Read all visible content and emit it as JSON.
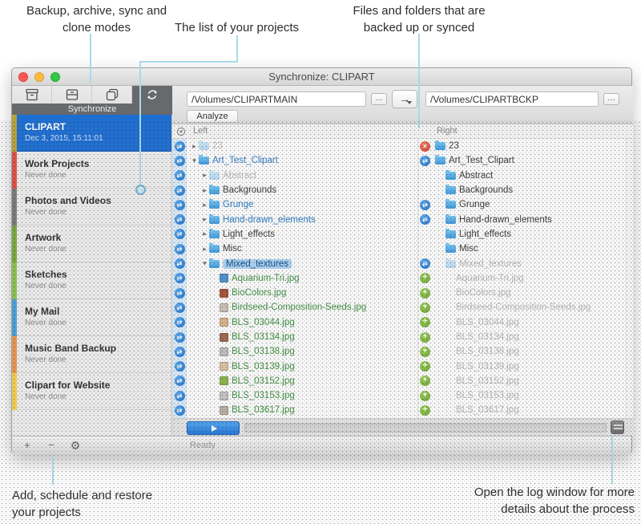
{
  "annotations": {
    "top_left": {
      "line1": "Backup, archive, sync and",
      "line2": "clone modes"
    },
    "top_mid": {
      "line1": "The list of your projects"
    },
    "top_right": {
      "line1": "Files and folders that are",
      "line2": "backed up or synced"
    },
    "bottom_left": {
      "line1": "Add, schedule and restore",
      "line2": "your projects"
    },
    "bottom_right": {
      "line1": "Open the log window for more",
      "line2": "details about the process"
    }
  },
  "icons": {
    "plus": "+",
    "minus": "−",
    "gear": "⚙",
    "sync_glyph": "⇄",
    "add_glyph": "+",
    "del_glyph": "×",
    "browse": "…",
    "direction": "→"
  },
  "colors": {
    "selection_blue": "#1d6ed3",
    "annotation_line": "#a9d9eb",
    "status_sync": "#2f86dd",
    "status_add": "#7cb342",
    "status_delete": "#e0503c"
  },
  "window": {
    "title": "Synchronize: CLIPART",
    "toolbar": {
      "modes": [
        "backup",
        "archive",
        "clone",
        "synchronize"
      ],
      "selected_mode_label": "Synchronize",
      "source_path": "/Volumes/CLIPARTMAIN",
      "dest_path": "/Volumes/CLIPARTBCKP",
      "analyze_label": "Analyze"
    },
    "sidebar": {
      "projects": [
        {
          "name": "CLIPART",
          "status": "Dec 3, 2015, 15:11:01",
          "color": "#b9a23a",
          "selected": true
        },
        {
          "name": "Work Projects",
          "status": "Never done",
          "color": "#dd5144",
          "selected": false
        },
        {
          "name": "Photos and Videos",
          "status": "Never done",
          "color": "#7a7a7a",
          "selected": false
        },
        {
          "name": "Artwork",
          "status": "Never done",
          "color": "#79a93e",
          "selected": false
        },
        {
          "name": "Sketches",
          "status": "Never done",
          "color": "#8cc152",
          "selected": false
        },
        {
          "name": "My Mail",
          "status": "Never done",
          "color": "#4a9fd8",
          "selected": false
        },
        {
          "name": "Music Band Backup",
          "status": "Never done",
          "color": "#e8964f",
          "selected": false
        },
        {
          "name": "Clipart for Website",
          "status": "Never done",
          "color": "#f2cf4e",
          "selected": false
        }
      ]
    },
    "filelist": {
      "left_header": "Left",
      "right_header": "Right",
      "rows": [
        {
          "li": "sync",
          "ri": "del",
          "l": {
            "d": 0,
            "c": "▸",
            "k": "folder-faint",
            "n": "23",
            "s": "faint"
          },
          "r": {
            "d": 0,
            "k": "folder",
            "n": "23",
            "s": "normal"
          }
        },
        {
          "li": "sync",
          "ri": "sync",
          "l": {
            "d": 0,
            "c": "▾",
            "k": "folder",
            "n": "Art_Test_Clipart",
            "s": "blue"
          },
          "r": {
            "d": 0,
            "k": "folder",
            "n": "Art_Test_Clipart",
            "s": "normal"
          }
        },
        {
          "li": "sync",
          "ri": null,
          "l": {
            "d": 1,
            "c": "▸",
            "k": "folder-faint",
            "n": "Abstract",
            "s": "faint"
          },
          "r": {
            "d": 1,
            "k": "folder",
            "n": "Abstract",
            "s": "normal"
          }
        },
        {
          "li": "sync",
          "ri": null,
          "l": {
            "d": 1,
            "c": "▸",
            "k": "folder",
            "n": "Backgrounds",
            "s": "normal"
          },
          "r": {
            "d": 1,
            "k": "folder",
            "n": "Backgrounds",
            "s": "normal"
          }
        },
        {
          "li": "sync",
          "ri": "sync",
          "l": {
            "d": 1,
            "c": "▸",
            "k": "folder",
            "n": "Grunge",
            "s": "blue"
          },
          "r": {
            "d": 1,
            "k": "folder",
            "n": "Grunge",
            "s": "normal"
          }
        },
        {
          "li": "sync",
          "ri": "sync",
          "l": {
            "d": 1,
            "c": "▸",
            "k": "folder",
            "n": "Hand-drawn_elements",
            "s": "blue"
          },
          "r": {
            "d": 1,
            "k": "folder",
            "n": "Hand-drawn_elements",
            "s": "normal"
          }
        },
        {
          "li": "sync",
          "ri": null,
          "l": {
            "d": 1,
            "c": "▸",
            "k": "folder",
            "n": "Light_effects",
            "s": "normal"
          },
          "r": {
            "d": 1,
            "k": "folder",
            "n": "Light_effects",
            "s": "normal"
          }
        },
        {
          "li": "sync",
          "ri": null,
          "l": {
            "d": 1,
            "c": "▸",
            "k": "folder",
            "n": "Misc",
            "s": "normal"
          },
          "r": {
            "d": 1,
            "k": "folder",
            "n": "Misc",
            "s": "normal"
          }
        },
        {
          "li": "sync",
          "ri": "sync",
          "l": {
            "d": 1,
            "c": "▾",
            "k": "folder",
            "n": "Mixed_textures",
            "s": "sel"
          },
          "r": {
            "d": 1,
            "k": "folder-faint",
            "n": "Mixed_textures",
            "s": "faint"
          }
        },
        {
          "li": "sync",
          "ri": "add",
          "l": {
            "d": 2,
            "k": "thumb",
            "t": "#4f94cd",
            "n": "Aquarium-Tri.jpg",
            "s": "green"
          },
          "r": {
            "d": 2,
            "k": "none",
            "n": "Aquarium-Tri.jpg",
            "s": "faint"
          }
        },
        {
          "li": "sync",
          "ri": "add",
          "l": {
            "d": 2,
            "k": "thumb",
            "t": "#a8543a",
            "n": "BioColors.jpg",
            "s": "green"
          },
          "r": {
            "d": 2,
            "k": "none",
            "n": "BioColors.jpg",
            "s": "faint"
          }
        },
        {
          "li": "sync",
          "ri": "add",
          "l": {
            "d": 2,
            "k": "thumb",
            "t": "#c8c2b6",
            "n": "Birdseed-Composition-Seeds.jpg",
            "s": "green"
          },
          "r": {
            "d": 2,
            "k": "none",
            "n": "Birdseed-Composition-Seeds.jpg",
            "s": "faint"
          }
        },
        {
          "li": "sync",
          "ri": "add",
          "l": {
            "d": 2,
            "k": "thumb",
            "t": "#d7b58d",
            "n": "BLS_03044.jpg",
            "s": "green"
          },
          "r": {
            "d": 2,
            "k": "none",
            "n": "BLS_03044.jpg",
            "s": "faint"
          }
        },
        {
          "li": "sync",
          "ri": "add",
          "l": {
            "d": 2,
            "k": "thumb",
            "t": "#9c6b4e",
            "n": "BLS_03134.jpg",
            "s": "green"
          },
          "r": {
            "d": 2,
            "k": "none",
            "n": "BLS_03134.jpg",
            "s": "faint"
          }
        },
        {
          "li": "sync",
          "ri": "add",
          "l": {
            "d": 2,
            "k": "thumb",
            "t": "#bdbdbd",
            "n": "BLS_03138.jpg",
            "s": "green"
          },
          "r": {
            "d": 2,
            "k": "none",
            "n": "BLS_03138.jpg",
            "s": "faint"
          }
        },
        {
          "li": "sync",
          "ri": "add",
          "l": {
            "d": 2,
            "k": "thumb",
            "t": "#d9c3a3",
            "n": "BLS_03139.jpg",
            "s": "green"
          },
          "r": {
            "d": 2,
            "k": "none",
            "n": "BLS_03139.jpg",
            "s": "faint"
          }
        },
        {
          "li": "sync",
          "ri": "add",
          "l": {
            "d": 2,
            "k": "thumb",
            "t": "#8fb54d",
            "n": "BLS_03152.jpg",
            "s": "green"
          },
          "r": {
            "d": 2,
            "k": "none",
            "n": "BLS_03152.jpg",
            "s": "faint"
          }
        },
        {
          "li": "sync",
          "ri": "add",
          "l": {
            "d": 2,
            "k": "thumb",
            "t": "#c4c4c4",
            "n": "BLS_03153.jpg",
            "s": "green"
          },
          "r": {
            "d": 2,
            "k": "none",
            "n": "BLS_03153.jpg",
            "s": "faint"
          }
        },
        {
          "li": "sync",
          "ri": "add",
          "l": {
            "d": 2,
            "k": "thumb",
            "t": "#b9b0a2",
            "n": "BLS_03617.jpg",
            "s": "green"
          },
          "r": {
            "d": 2,
            "k": "none",
            "n": "BLS_03617.jpg",
            "s": "faint"
          }
        }
      ]
    },
    "statusbar": {
      "ready": "Ready"
    }
  }
}
